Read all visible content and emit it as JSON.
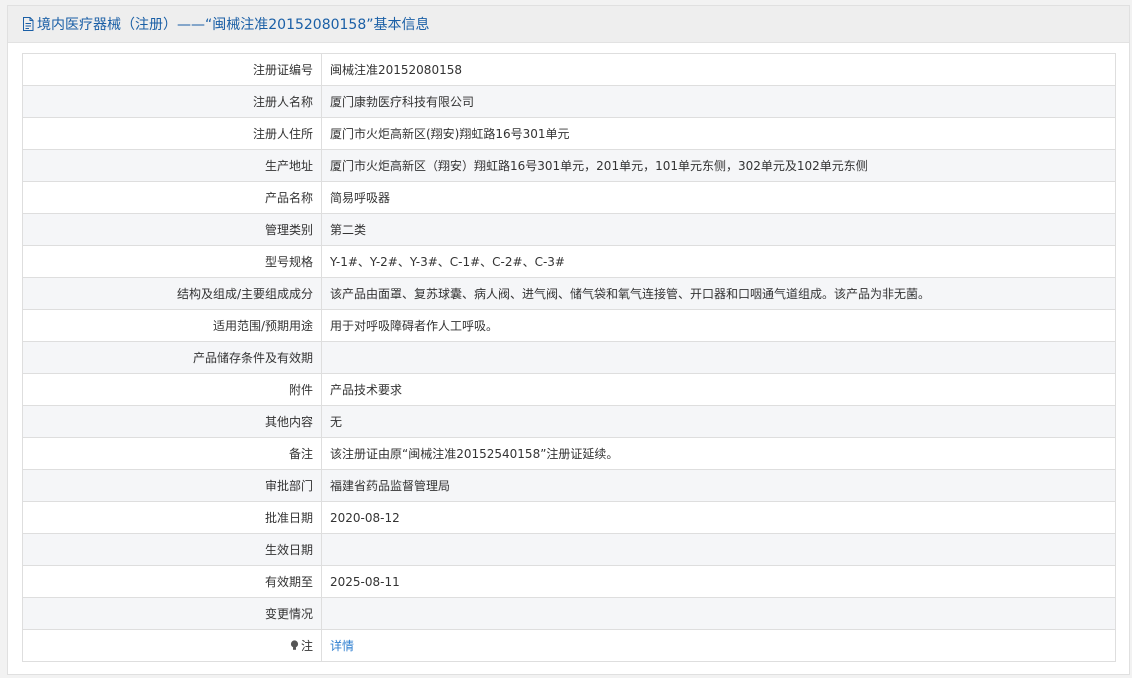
{
  "header": {
    "title": "境内医疗器械（注册）——“闽械注准20152080158”基本信息",
    "icon": "document-icon"
  },
  "rows": [
    {
      "label": "注册证编号",
      "value": "闽械注准20152080158"
    },
    {
      "label": "注册人名称",
      "value": "厦门康勃医疗科技有限公司"
    },
    {
      "label": "注册人住所",
      "value": "厦门市火炬高新区(翔安)翔虹路16号301单元"
    },
    {
      "label": "生产地址",
      "value": "厦门市火炬高新区（翔安）翔虹路16号301单元，201单元，101单元东侧，302单元及102单元东侧"
    },
    {
      "label": "产品名称",
      "value": "简易呼吸器"
    },
    {
      "label": "管理类别",
      "value": "第二类"
    },
    {
      "label": "型号规格",
      "value": "Y-1#、Y-2#、Y-3#、C-1#、C-2#、C-3#"
    },
    {
      "label": "结构及组成/主要组成成分",
      "value": "该产品由面罩、复苏球囊、病人阀、进气阀、储气袋和氧气连接管、开口器和口咽通气道组成。该产品为非无菌。"
    },
    {
      "label": "适用范围/预期用途",
      "value": "用于对呼吸障碍者作人工呼吸。"
    },
    {
      "label": "产品储存条件及有效期",
      "value": ""
    },
    {
      "label": "附件",
      "value": "产品技术要求"
    },
    {
      "label": "其他内容",
      "value": "无"
    },
    {
      "label": "备注",
      "value": "该注册证由原“闽械注准20152540158”注册证延续。"
    },
    {
      "label": "审批部门",
      "value": "福建省药品监督管理局"
    },
    {
      "label": "批准日期",
      "value": "2020-08-12"
    },
    {
      "label": "生效日期",
      "value": ""
    },
    {
      "label": "有效期至",
      "value": "2025-08-11"
    },
    {
      "label": "变更情况",
      "value": ""
    }
  ],
  "note_row": {
    "label": "注",
    "icon": "lightbulb-icon",
    "link_text": "详情"
  },
  "colors": {
    "header_text": "#1a5fa6",
    "link": "#2f7fd0",
    "border": "#dedede",
    "alt_row": "#f5f6f8"
  }
}
